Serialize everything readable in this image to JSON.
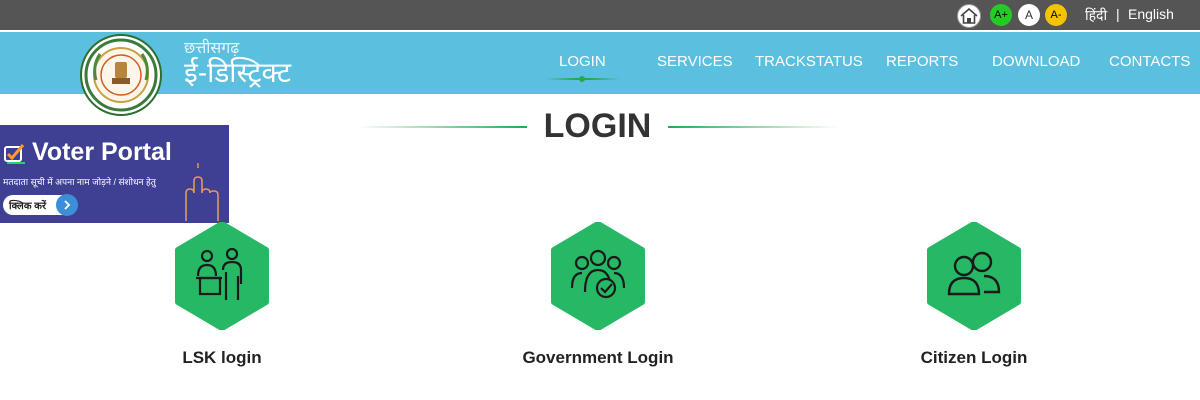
{
  "topbar": {
    "font_increase": "A+",
    "font_normal": "A",
    "font_decrease": "A-",
    "lang_hindi": "हिंदी",
    "lang_separator": "|",
    "lang_english": "English"
  },
  "header": {
    "brand_small": "छत्तीसगढ़",
    "brand_big": "ई-डिस्ट्रिक्ट",
    "emblem_icon": "chhattisgarh-emblem-icon",
    "nav": {
      "login": "LOGIN",
      "services": "SERVICES",
      "trackstatus": "TRACKSTATUS",
      "reports": "REPORTS",
      "download": "DOWNLOAD",
      "contacts": "CONTACTS"
    },
    "colors": {
      "bar": "#5bbfdf",
      "accent": "#22aa50"
    }
  },
  "main": {
    "title": "LOGIN",
    "voter_banner": {
      "title": "Voter Portal",
      "subtitle": "मतदाता सूची में अपना नाम जोड़ने / संशोधन हेतु",
      "button": "क्लिक करें"
    },
    "cards": [
      {
        "label": "LSK login",
        "icon": "lsk-operator-icon"
      },
      {
        "label": "Government Login",
        "icon": "government-group-icon"
      },
      {
        "label": "Citizen Login",
        "icon": "citizen-users-icon"
      }
    ],
    "colors": {
      "hexagon": "#26b865"
    }
  }
}
